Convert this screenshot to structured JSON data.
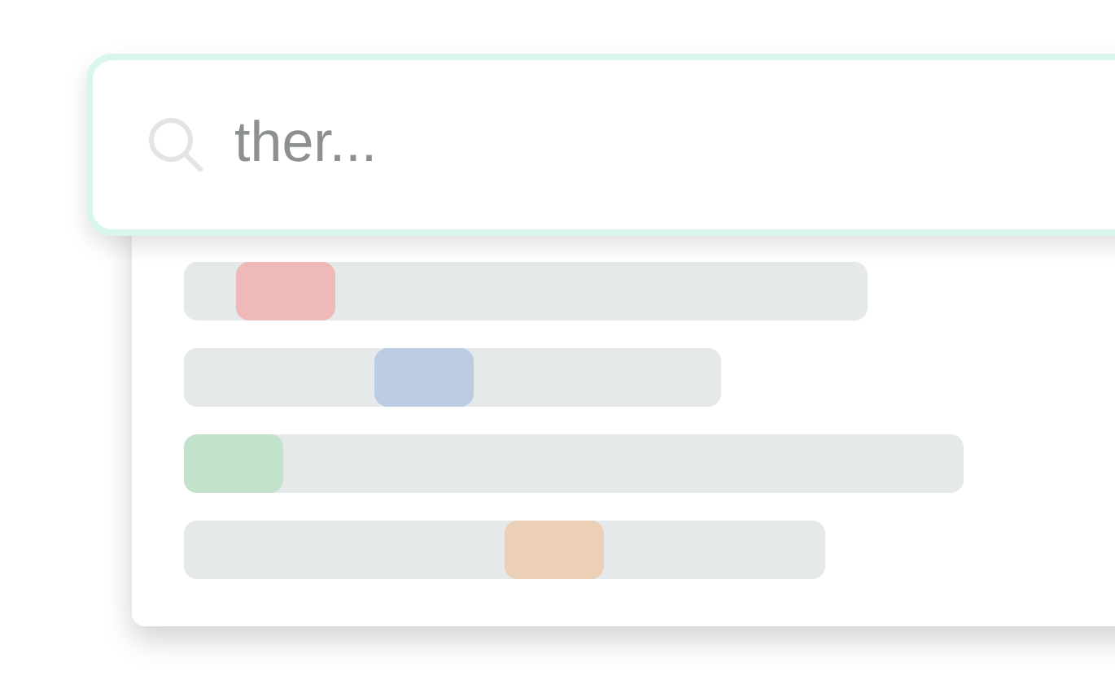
{
  "search": {
    "value": "ther..."
  },
  "results": [
    {
      "color": "#f0b9b9"
    },
    {
      "color": "#bccde3"
    },
    {
      "color": "#c2e2cc"
    },
    {
      "color": "#ebcfb6"
    }
  ]
}
